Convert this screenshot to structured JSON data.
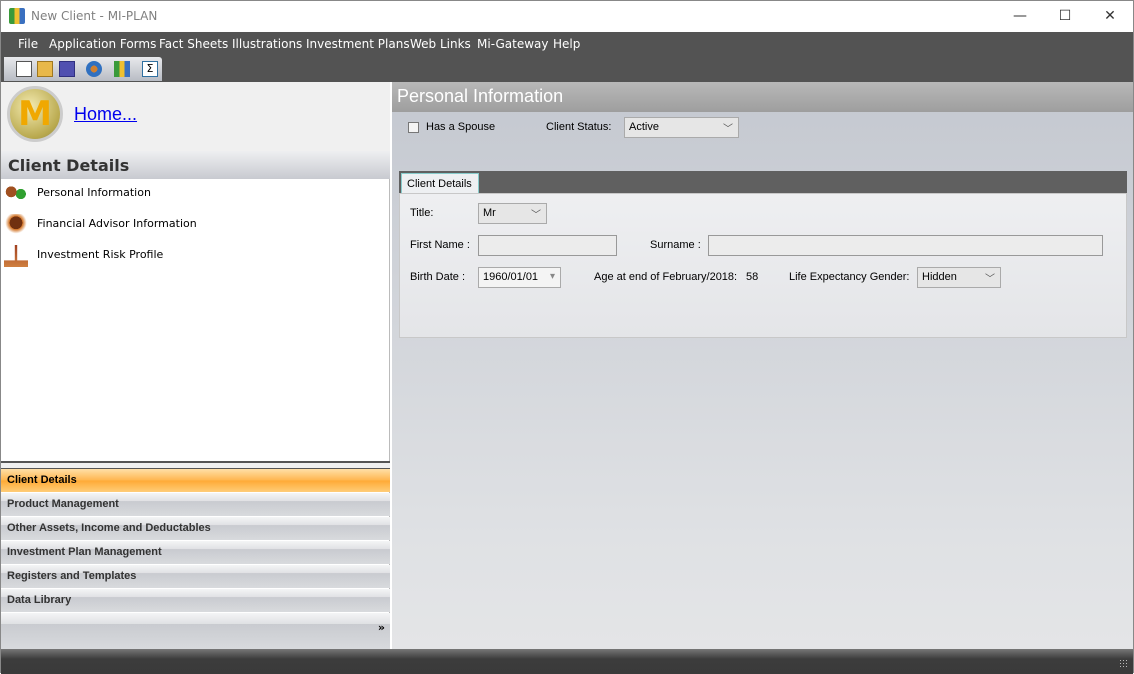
{
  "window": {
    "title": "New Client - MI-PLAN",
    "minimize": "—",
    "maximize": "☐",
    "close": "✕"
  },
  "menu": [
    "File",
    "Application Forms",
    "Fact Sheets",
    "Illustrations",
    "Investment Plans",
    "Web Links",
    "Mi-Gateway",
    "Help"
  ],
  "toolbar": [
    "new-icon",
    "open-icon",
    "save-icon",
    "clients-icon",
    "miplan-icon",
    "sum-icon"
  ],
  "left": {
    "logo_letter": "M",
    "home_link": "Home...",
    "section_title": "Client Details",
    "items": [
      {
        "label": "Personal Information",
        "icon": "people-icon"
      },
      {
        "label": "Financial Advisor Information",
        "icon": "advisor-icon"
      },
      {
        "label": "Investment Risk Profile",
        "icon": "scales-icon"
      }
    ],
    "nav": [
      "Client Details",
      "Product Management",
      "Other Assets, Income and Deductables",
      "Investment Plan Management",
      "Registers and Templates",
      "Data Library"
    ],
    "nav_selected": 0,
    "overflow": "»"
  },
  "main": {
    "title": "Personal Information",
    "has_spouse_label": "Has a Spouse",
    "has_spouse": false,
    "client_status_label": "Client Status:",
    "client_status": "Active",
    "tab": "Client Details",
    "title_label": "Title:",
    "title_value": "Mr",
    "first_name_label": "First Name :",
    "first_name": "",
    "surname_label": "Surname :",
    "surname": "",
    "birth_date_label": "Birth Date :",
    "birth_date": "1960/01/01",
    "age_label": "Age at end of February/2018:",
    "age": "58",
    "gender_label": "Life Expectancy Gender:",
    "gender": "Hidden"
  },
  "colors": {
    "accent": "#ffaa35",
    "menubar": "#535353",
    "link": "#0000ee"
  }
}
